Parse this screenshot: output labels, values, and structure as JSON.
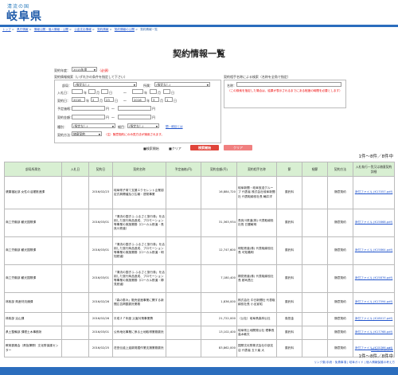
{
  "header": {
    "logo_small": "清流の国",
    "logo_main": "岐阜県",
    "breadcrumb": [
      "トップ",
      "県庁情報",
      "情報公開・個人情報・公開",
      "公金支出情報",
      "契約情報",
      "契約情報の公開",
      "契約情報一覧"
    ]
  },
  "page_title": "契約情報一覧",
  "form": {
    "fiscal_year_label": "契約年度：",
    "fiscal_year_value": "2015年度",
    "required_mark": "（必須）",
    "left_panel_title": "契約情報検索（いずれかの条件を指定して下さい）",
    "dept_label": "部局：",
    "dept_value": "(指定なし)",
    "section_label": "所属：",
    "section_value": "(指定なし)",
    "bid_date_label": "入札日：",
    "contract_date_label": "契約日：",
    "cd_from_year": "2016",
    "cd_from_month": "2",
    "cd_from_day": "23",
    "cd_to_year": "2016",
    "cd_to_month": "3",
    "cd_to_day": "1",
    "unit_year": "年",
    "unit_month": "月",
    "unit_day": "日",
    "range_sep": "～",
    "estimate_label": "予定価格：",
    "contract_amount_label": "契約金額：",
    "yen": "円",
    "category_label": "種別：",
    "category_value": "(指定なし)",
    "subcategory_label": "細目：",
    "subcategory_value": "(指定なし)",
    "collapse_link": "閉・細目とは",
    "method_label": "契約方法：",
    "method_value": "随意契約",
    "method_note": "（注）随意契約にのみ見方法が適用されます。",
    "right_panel_title": "契約相手名称による検索（名称を全角で指定）",
    "name_label": "名称：",
    "right_note": "（この検索を指定した場合は、結果が表示されるまでにある程度の時間を必要とします）",
    "show_label": "検索開始",
    "clear_label": "クリア",
    "search_button": "検索開始",
    "clear_button": "クリア"
  },
  "result_count": "1件～8件／8件中",
  "table": {
    "headers": [
      "部局所属名",
      "入札日",
      "契約日",
      "契約名称",
      "予定価格(円)",
      "契約金額(円)",
      "契約相手名称",
      "節",
      "細節",
      "契約方法",
      "入札執行一覧又は随意契約詳細"
    ],
    "rows": [
      [
        "健康福祉部 女性の活躍推進課",
        "",
        "2016/02/23",
        "岐阜県子育て支援エクセレント企業認定式典開催及び広報・啓発事業",
        "",
        "16,884,720",
        "岐阜新聞・岐阜放送グループ 代表者 株式会社岐阜新聞社 代表取締役社長 輪井洋",
        "委託料",
        "",
        "随意契約",
        "添付ファイル (K17057.pdf)"
      ],
      [
        "商工労働部 観光国際課",
        "",
        "2016/03/01",
        "「清流の国ぎふ ふるさと旅行券」を活用した旅行商品造成、プロモーション等事業の実施業務（ローカル鉄道・長良川鉄道）",
        "",
        "31,363,934",
        "長良川鉄道(株) 代表取締役社長 日置敏明",
        "委託料",
        "",
        "随意契約",
        "添付ファイル (K15868.pdf)"
      ],
      [
        "商工労働部 観光国際課",
        "",
        "2016/03/01",
        "「清流の国ぎふ ふるさと旅行券」を活用した旅行商品造成、プロモーション等事業の実施業務（ローカル鉄道・明知鉄道）",
        "",
        "12,747,600",
        "明知鉄道(株) 代表取締役社長 可知義明",
        "委託料",
        "",
        "随意契約",
        "添付ファイル (K15864.pdf)"
      ],
      [
        "商工労働部 観光国際課",
        "",
        "2016/03/01",
        "「清流の国ぎふ ふるさと旅行券」を活用した旅行商品造成、プロモーション等事業の実施業務（ローカル鉄道・樽見鉄道）",
        "",
        "7,180,400",
        "樽見鉄道(株) 代表取締役社長 都司昌士",
        "委託料",
        "",
        "随意契約",
        "添付ファイル (K15876.pdf)"
      ],
      [
        "林政部 県産材流通課",
        "",
        "2016/02/26",
        "「森の恵み」販売促進事業に関する新聞広告掲載委託業務",
        "",
        "1,836,000",
        "株式会社 中日新聞社 代表取締役社長 小出宣昭",
        "委託料",
        "",
        "随意契約",
        "添付ファイル (K17594.pdf)"
      ],
      [
        "林政部 治山課",
        "",
        "2016/02/26",
        "平成２７年度 災害対策事業費",
        "",
        "21,722,000",
        "（公社）岐阜県森林公社",
        "負担金",
        "",
        "随意契約",
        "添付ファイル (K18017.pdf)"
      ],
      [
        "県土整備部 課理土木事務所",
        "",
        "2016/03/01",
        "公有地化事業に係る土地取得業務委託",
        "",
        "13,102,400",
        "岐阜県土地開発公社 理事長 高木敏夫",
        "委託料",
        "",
        "随意契約",
        "添付ファイル (K17768.pdf)"
      ],
      [
        "教育委員会（県指揮際）文化財保護センター",
        "",
        "2016/02/25",
        "荘田伝遺上遺跡発掘作業支援業務委託",
        "",
        "83,862,000",
        "国際文化財株式会社中部支店 代表者 五十嵐 大",
        "委託料",
        "",
        "随意契約",
        "添付ファイル (K15766.pdf)"
      ]
    ]
  },
  "page_top_link": "ページトップへ",
  "result_count_bottom": "1件～8件／8件中",
  "footer": {
    "links": "リンク集/手続・免責事項 | 岐阜ガイド | 個人情報保護の考え方"
  },
  "colors": {
    "brand_blue": "#2b6dbd",
    "header_green": "#d8efd2",
    "button_red": "#e0443a"
  }
}
